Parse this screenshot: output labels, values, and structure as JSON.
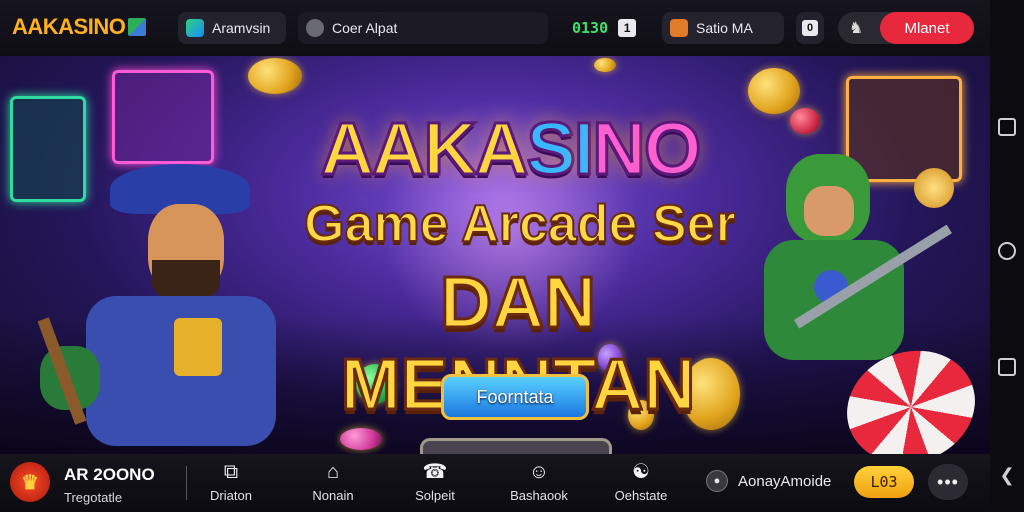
{
  "header": {
    "logo_text": "AAKASINO",
    "app_link_label": "Aramvsin",
    "search_text": "Coer Alpat",
    "counter_value": "0130",
    "counter_badge": "1",
    "game_link_label": "Satio MA",
    "small_badge": "0",
    "user_glyph": "♞",
    "main_button_label": "Mlanet"
  },
  "hero": {
    "title_line1": "AAKASINO",
    "title_line2": "Game Arcade Ser",
    "title_line3": "DAN MENNTAN",
    "cta_label": "Foorntata"
  },
  "bottom": {
    "brand_title": "AR 2OONO",
    "brand_subtitle": "Tregotatle",
    "nav": [
      {
        "label": "Driaton",
        "icon": "copy-icon"
      },
      {
        "label": "Nonain",
        "icon": "home-icon"
      },
      {
        "label": "Solpeit",
        "icon": "support-icon"
      },
      {
        "label": "Bashaook",
        "icon": "user-icon"
      },
      {
        "label": "Oehstate",
        "icon": "chat-icon"
      }
    ],
    "user_name": "AonayАmoide",
    "balance": "L03",
    "more_label": "•••"
  },
  "colors": {
    "accent_red": "#e8283c",
    "accent_gold": "#ffd23a",
    "counter_green": "#3fe06c",
    "hero_purple": "#4a2a9a"
  }
}
